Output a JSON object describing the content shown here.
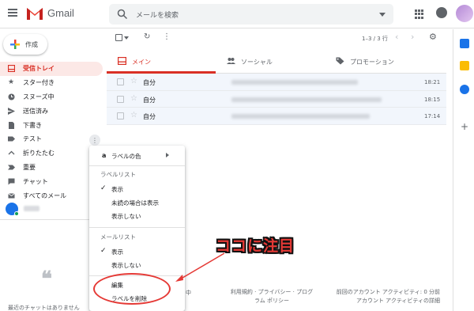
{
  "header": {
    "brand": "Gmail",
    "search_placeholder": "メールを検索"
  },
  "compose": {
    "label": "作成"
  },
  "sidebar": {
    "items": [
      {
        "label": "受信トレイ",
        "icon": "inbox-icon",
        "active": true
      },
      {
        "label": "スター付き",
        "icon": "star-icon"
      },
      {
        "label": "スヌーズ中",
        "icon": "clock-icon"
      },
      {
        "label": "送信済み",
        "icon": "send-icon"
      },
      {
        "label": "下書き",
        "icon": "draft-icon"
      },
      {
        "label": "テスト",
        "icon": "label-icon"
      },
      {
        "label": "折りたたむ",
        "icon": "chevron-up-icon"
      },
      {
        "label": "重要",
        "icon": "important-icon"
      },
      {
        "label": "チャット",
        "icon": "chat-icon"
      },
      {
        "label": "すべてのメール",
        "icon": "mail-icon"
      }
    ],
    "no_chat_text": "最近のチャットはありません"
  },
  "toolbar": {
    "count": "1–3 / 3 行"
  },
  "tabs": [
    {
      "label": "メイン",
      "icon": "inbox-icon",
      "active": true
    },
    {
      "label": "ソーシャル",
      "icon": "people-icon"
    },
    {
      "label": "プロモーション",
      "icon": "tag-icon"
    }
  ],
  "emails": [
    {
      "sender": "自分",
      "time": "18:21"
    },
    {
      "sender": "自分",
      "time": "18:15"
    },
    {
      "sender": "自分",
      "time": "17:14"
    }
  ],
  "footer": {
    "small": "中",
    "links": "利用規約 · プライバシー · プログラム ポリシー",
    "activity": "前回のアカウント アクティビティ: 0 分前",
    "activity_detail": "アカウント アクティビティの詳細"
  },
  "label_menu": {
    "label_color": "ラベルの色",
    "label_list_heading": "ラベルリスト",
    "label_list_options": [
      "表示",
      "未読の場合は表示",
      "表示しない"
    ],
    "mail_list_heading": "メールリスト",
    "mail_list_options": [
      "表示",
      "表示しない"
    ],
    "edit": "編集",
    "delete": "ラベルを削除"
  },
  "annotation": {
    "text": "ココに注目",
    "color": "#e53935"
  },
  "colors": {
    "accent_red": "#d93025",
    "active_bg": "#fce8e6",
    "row_bg": "#f2f6fc"
  }
}
